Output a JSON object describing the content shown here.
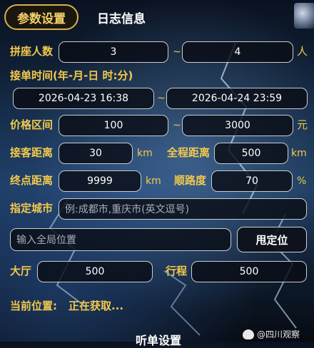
{
  "tabs": {
    "settings": "参数设置",
    "log": "日志信息"
  },
  "seat_count": {
    "label": "拼座人数",
    "min": "3",
    "max": "4",
    "unit": "人",
    "sep": "~"
  },
  "order_time": {
    "label": "接单时间(年-月-日 时:分)",
    "start": "2026-04-23 16:38",
    "end": "2026-04-24 23:59",
    "sep": "~"
  },
  "price": {
    "label": "价格区间",
    "min": "100",
    "max": "3000",
    "unit": "元",
    "sep": "~"
  },
  "pickup_distance": {
    "label": "接客距离",
    "value": "30",
    "unit": "km"
  },
  "total_distance": {
    "label": "全程距离",
    "value": "500",
    "unit": "km"
  },
  "end_distance": {
    "label": "终点距离",
    "value": "9999",
    "unit": "km"
  },
  "route_match": {
    "label": "顺路度",
    "value": "70",
    "unit": "%"
  },
  "city": {
    "label": "指定城市",
    "placeholder": "例:成都市,重庆市(英文逗号)"
  },
  "global_location": {
    "placeholder": "输入全局位置",
    "button": "甩定位"
  },
  "hall": {
    "label": "大厅",
    "value": "500"
  },
  "trip": {
    "label": "行程",
    "value": "500"
  },
  "current_location": {
    "label": "当前位置:",
    "value": "正在获取..."
  },
  "bottom": {
    "title": "听单设置"
  },
  "watermark": {
    "text": "@四川观察"
  }
}
